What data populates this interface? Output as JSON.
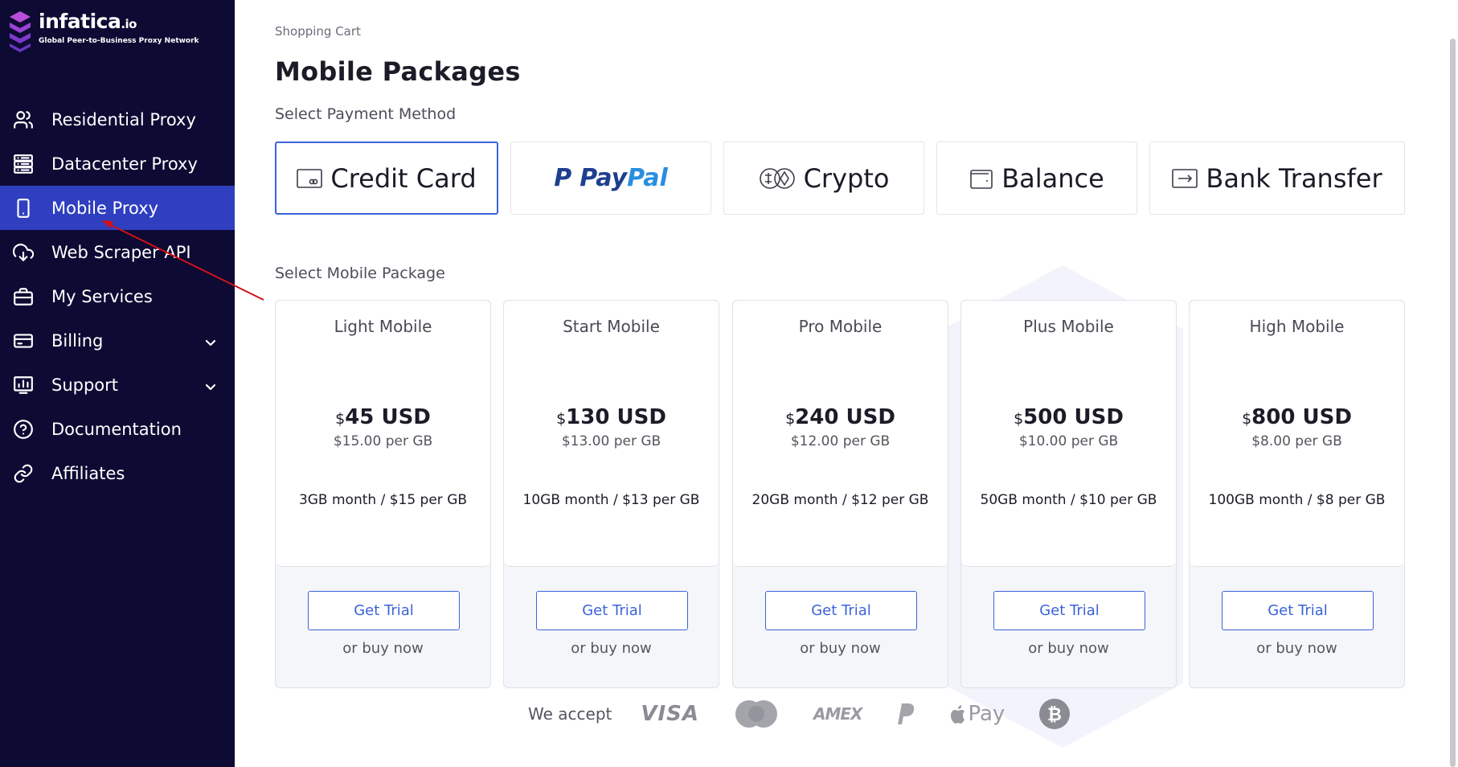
{
  "brand": {
    "name": "infatica",
    "suffix": ".io",
    "tagline": "Global Peer-to-Business Proxy Network"
  },
  "sidebar": {
    "items": [
      {
        "label": "Residential Proxy",
        "icon": "users-icon"
      },
      {
        "label": "Datacenter Proxy",
        "icon": "server-icon"
      },
      {
        "label": "Mobile Proxy",
        "icon": "smartphone-icon",
        "active": true
      },
      {
        "label": "Web Scraper API",
        "icon": "cloud-download-icon"
      },
      {
        "label": "My Services",
        "icon": "briefcase-icon"
      },
      {
        "label": "Billing",
        "icon": "credit-card-icon",
        "expandable": true
      },
      {
        "label": "Support",
        "icon": "bar-chart-icon",
        "expandable": true
      },
      {
        "label": "Documentation",
        "icon": "help-circle-icon"
      },
      {
        "label": "Affiliates",
        "icon": "link-icon"
      }
    ]
  },
  "main": {
    "breadcrumb": "Shopping Cart",
    "title": "Mobile Packages",
    "payment_label": "Select Payment Method",
    "payment_methods": [
      {
        "label": "Credit Card",
        "icon": "credit-card-icon",
        "selected": true
      },
      {
        "label": "PayPal",
        "icon": "paypal-logo"
      },
      {
        "label": "Crypto",
        "icon": "crypto-icon"
      },
      {
        "label": "Balance",
        "icon": "wallet-icon"
      },
      {
        "label": "Bank Transfer",
        "icon": "bank-transfer-icon"
      }
    ],
    "package_label": "Select Mobile Package",
    "packages": [
      {
        "name": "Light Mobile",
        "currency": "$",
        "price": "45 USD",
        "per_gb": "$15.00 per GB",
        "desc": "3GB month / $15 per GB",
        "trial": "Get Trial",
        "buy": "or buy now"
      },
      {
        "name": "Start Mobile",
        "currency": "$",
        "price": "130 USD",
        "per_gb": "$13.00 per GB",
        "desc": "10GB month / $13 per GB",
        "trial": "Get Trial",
        "buy": "or buy now"
      },
      {
        "name": "Pro Mobile",
        "currency": "$",
        "price": "240 USD",
        "per_gb": "$12.00 per GB",
        "desc": "20GB month / $12 per GB",
        "trial": "Get Trial",
        "buy": "or buy now"
      },
      {
        "name": "Plus Mobile",
        "currency": "$",
        "price": "500 USD",
        "per_gb": "$10.00 per GB",
        "desc": "50GB month / $10 per GB",
        "trial": "Get Trial",
        "buy": "or buy now"
      },
      {
        "name": "High Mobile",
        "currency": "$",
        "price": "800 USD",
        "per_gb": "$8.00 per GB",
        "desc": "100GB month / $8 per GB",
        "trial": "Get Trial",
        "buy": "or buy now"
      }
    ],
    "accept": {
      "label": "We accept",
      "visa": "VISA",
      "amex": "AMEX",
      "applepay": "Pay"
    }
  },
  "colors": {
    "sidebar_bg": "#0d0a33",
    "active_bg": "#2f3fbf",
    "accent": "#3b63d9",
    "annotation_arrow": "#d0121b"
  }
}
